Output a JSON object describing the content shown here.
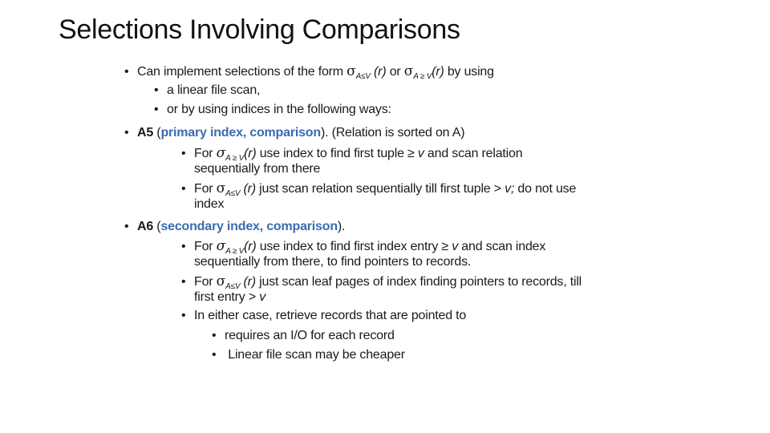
{
  "slide": {
    "title": "Selections Involving Comparisons",
    "accent_color": "#3c6ab0",
    "l1": {
      "pre": "Can implement selections of the form ",
      "sigma": "σ",
      "sub1": "A≤V",
      "r1": " (r)",
      "or": " or ",
      "sub2": "A ≥ V",
      "r2": "(r)",
      "post": " by using"
    },
    "l2": "a linear file scan,",
    "l3": "or by using indices in the following ways:",
    "a5": {
      "label": "A5",
      "open": " (",
      "blue": "primary index, comparison",
      "close": "). (Relation is sorted on A)"
    },
    "a5_1": {
      "pre": "For ",
      "sigma": "σ",
      "sub": "A ≥ V",
      "r": "(r)",
      "mid": "  use index to find first tuple ≥ ",
      "v": "v",
      "post": "  and scan relation"
    },
    "a5_1b": "sequentially  from there",
    "a5_2": {
      "pre": "For ",
      "sigma": "σ",
      "sub": "A≤V",
      "r": " (r)",
      "mid": " just scan relation sequentially till first tuple > ",
      "v": "v;",
      "post": " do not use"
    },
    "a5_2b": "index",
    "a6": {
      "label": "A6",
      "open": " (",
      "blue": "secondary index, comparison",
      "close": ")."
    },
    "a6_1": {
      "pre": "For ",
      "sigma": "σ",
      "sub": "A ≥ V",
      "r": "(r)",
      "mid": "  use index to find first index entry ≥ ",
      "v": "v",
      "post": " and scan index"
    },
    "a6_1b": "sequentially  from there, to find pointers to records.",
    "a6_2": {
      "pre": "For ",
      "sigma": "σ",
      "sub": "A≤V",
      "r": " (r)",
      "post": " just scan leaf pages of index finding pointers to records, till"
    },
    "a6_2b": {
      "pre": "first entry > ",
      "v": "v"
    },
    "a6_3": "In either case, retrieve records that are pointed to",
    "a6_3_1": "requires an I/O for each record",
    "a6_3_2": " Linear file scan may be cheaper",
    "bullet": "•"
  }
}
